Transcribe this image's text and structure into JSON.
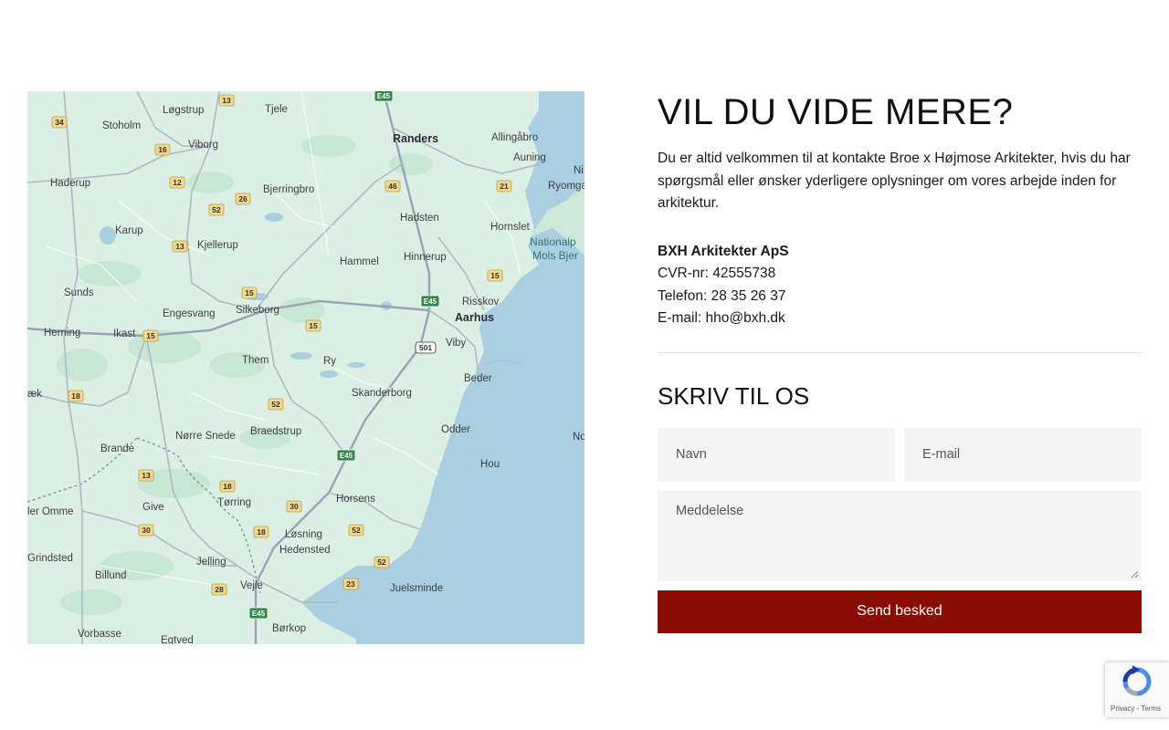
{
  "contact": {
    "title": "VIL DU VIDE MERE?",
    "intro": "Du er altid velkommen til at kontakte Broe x Højmose Arkitekter, hvis du har spørgsmål eller ønsker yderligere oplysninger om vores arbejde inden for arkitektur.",
    "company": "BXH Arkitekter ApS",
    "cvr": "CVR-nr: 42555738",
    "phone": "Telefon: 28 35 26 37",
    "email": "E-mail: hho@bxh.dk"
  },
  "form": {
    "title": "SKRIV TIL OS",
    "name_placeholder": "Navn",
    "email_placeholder": "E-mail",
    "message_placeholder": "Meddelelse",
    "submit_label": "Send besked"
  },
  "recaptcha": {
    "links": "Privacy - Terms"
  },
  "map": {
    "places": [
      "Løgstrup",
      "Tjele",
      "Stoholm",
      "Viborg",
      "Randers",
      "Allingåbro",
      "Auning",
      "Ni",
      "Ryomga",
      "Haderup",
      "Bjerringbro",
      "Hadsten",
      "Hornslet",
      "Nationalp",
      "Mols Bjer",
      "Karup",
      "Kjellerup",
      "Hammel",
      "Hinnerup",
      "Sunds",
      "Engesvang",
      "Silkeborg",
      "Risskov",
      "Aarhus",
      "Herning",
      "Ikast",
      "Viby",
      "Them",
      "Ry",
      "Beder",
      "æk",
      "Skanderborg",
      "Nørre Snede",
      "Braedstrup",
      "Odder",
      "Brande",
      "No",
      "Hou",
      "Horsens",
      "Tørring",
      "ler Omme",
      "Give",
      "Løsning",
      "Hedensted",
      "Grindsted",
      "Jelling",
      "Billund",
      "Vejle",
      "Juelsminde",
      "Vorbasse",
      "Børkop",
      "Egtved"
    ],
    "shields": [
      "13",
      "34",
      "16",
      "12",
      "52",
      "26",
      "46",
      "21",
      "13",
      "15",
      "15",
      "15",
      "15",
      "18",
      "52",
      "13",
      "18",
      "30",
      "30",
      "18",
      "52",
      "52",
      "23",
      "28"
    ],
    "euro_shields": [
      "E45",
      "E45",
      "E45",
      "E45"
    ],
    "route_label": "501"
  }
}
